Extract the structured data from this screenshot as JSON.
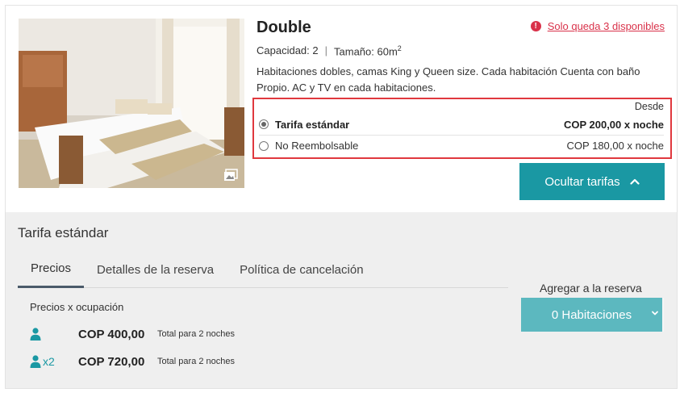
{
  "room": {
    "title": "Double",
    "availability": "Solo queda 3 disponibles",
    "capacity": "Capacidad: 2",
    "separator": "|",
    "size_label": "Tamaño: 60m",
    "size_sup": "2",
    "description": "Habitaciones dobles, camas King y Queen size. Cada habitación Cuenta con baño Propio. AC y TV en cada habitaciones."
  },
  "rates": {
    "from_label": "Desde",
    "options": [
      {
        "name": "Tarifa estándar",
        "price": "COP 200,00 x noche",
        "selected": true
      },
      {
        "name": "No Reembolsable",
        "price": "COP 180,00 x noche",
        "selected": false
      }
    ],
    "hide_button": "Ocultar tarifas"
  },
  "details": {
    "title": "Tarifa estándar",
    "tabs": [
      "Precios",
      "Detalles de la reserva",
      "Política de cancelación"
    ],
    "active_tab": 0,
    "occupancy_label": "Precios x ocupación",
    "prices": [
      {
        "multiplier": "",
        "amount": "COP 400,00",
        "note": "Total para 2 noches"
      },
      {
        "multiplier": "x2",
        "amount": "COP 720,00",
        "note": "Total para 2 noches"
      }
    ],
    "add_label": "Agregar a la reserva",
    "rooms_select": "0 Habitaciones"
  },
  "colors": {
    "accent": "#1a98a3",
    "accent_light": "#5cb8bf",
    "alert": "#d9324a",
    "highlight_border": "#e0383e"
  },
  "icons": {
    "gallery": "gallery-icon",
    "warning": "warning-icon",
    "chevron_up": "chevron-up-icon",
    "chevron_down": "chevron-down-icon",
    "person": "person-icon"
  }
}
